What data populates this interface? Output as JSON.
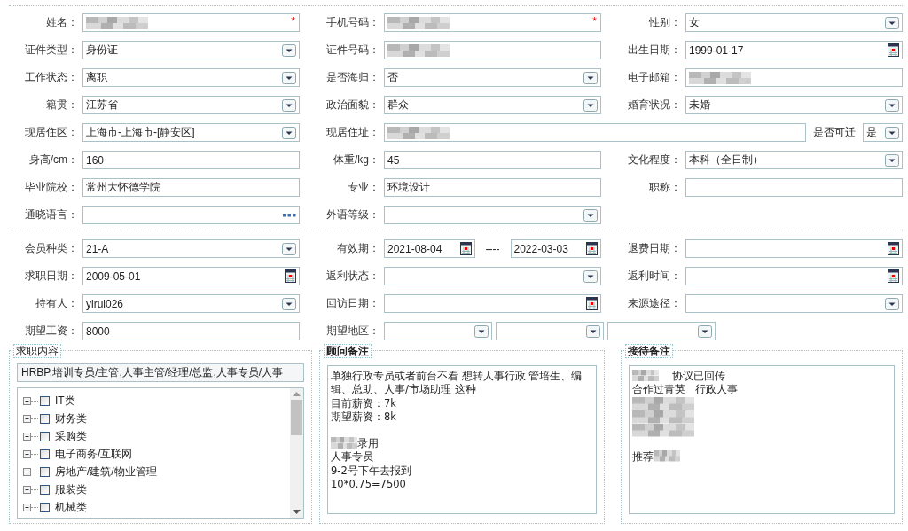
{
  "basic_rows": [
    [
      {
        "label": "姓名：",
        "controls": [
          {
            "kind": "text",
            "redacted": true,
            "required_mark": "*"
          }
        ]
      },
      {
        "label": "手机号码：",
        "controls": [
          {
            "kind": "text",
            "redacted": true,
            "required_mark": "*"
          }
        ]
      },
      {
        "label": "性别：",
        "controls": [
          {
            "kind": "select",
            "value": "女"
          }
        ]
      }
    ],
    [
      {
        "label": "证件类型：",
        "controls": [
          {
            "kind": "select",
            "value": "身份证"
          }
        ]
      },
      {
        "label": "证件号码：",
        "controls": [
          {
            "kind": "text",
            "redacted": true
          }
        ]
      },
      {
        "label": "出生日期：",
        "controls": [
          {
            "kind": "date",
            "value": "1999-01-17"
          }
        ]
      }
    ],
    [
      {
        "label": "工作状态：",
        "controls": [
          {
            "kind": "select",
            "value": "离职"
          }
        ]
      },
      {
        "label": "是否海归：",
        "controls": [
          {
            "kind": "select",
            "value": "否"
          }
        ]
      },
      {
        "label": "电子邮箱：",
        "controls": [
          {
            "kind": "text",
            "redacted": true
          }
        ]
      }
    ],
    [
      {
        "label": "籍贯：",
        "controls": [
          {
            "kind": "select",
            "value": "江苏省"
          }
        ]
      },
      {
        "label": "政治面貌：",
        "controls": [
          {
            "kind": "select",
            "value": "群众"
          }
        ]
      },
      {
        "label": "婚育状况：",
        "controls": [
          {
            "kind": "select",
            "value": "未婚"
          }
        ]
      }
    ],
    [
      {
        "label": "现居住区：",
        "controls": [
          {
            "kind": "select",
            "value": "上海市-上海市-[静安区]"
          }
        ]
      },
      {
        "label": "现居住址：",
        "controls": [
          {
            "kind": "text",
            "redacted": true
          },
          {
            "kind": "caption",
            "text": "是否可迁"
          },
          {
            "kind": "mini-select",
            "value": "是"
          }
        ]
      }
    ],
    [
      {
        "label": "身高/cm：",
        "controls": [
          {
            "kind": "text",
            "value": "160"
          }
        ]
      },
      {
        "label": "体重/kg：",
        "controls": [
          {
            "kind": "text",
            "value": "45"
          }
        ]
      },
      {
        "label": "文化程度：",
        "controls": [
          {
            "kind": "select",
            "value": "本科（全日制）"
          }
        ]
      }
    ],
    [
      {
        "label": "毕业院校：",
        "controls": [
          {
            "kind": "text",
            "value": "常州大怀德学院"
          }
        ]
      },
      {
        "label": "专业：",
        "controls": [
          {
            "kind": "text",
            "value": "环境设计"
          }
        ]
      },
      {
        "label": "职称：",
        "controls": [
          {
            "kind": "text"
          }
        ]
      }
    ],
    [
      {
        "label": "通晓语言：",
        "controls": [
          {
            "kind": "picker"
          }
        ]
      },
      {
        "label": "外语等级：",
        "controls": [
          {
            "kind": "select"
          }
        ]
      }
    ]
  ],
  "member_rows": [
    [
      {
        "label": "会员种类：",
        "controls": [
          {
            "kind": "select",
            "value": "21-A"
          }
        ]
      },
      {
        "label": "有效期：",
        "controls": [
          {
            "kind": "date",
            "value": "2021-08-04"
          },
          {
            "kind": "separator",
            "text": "----"
          },
          {
            "kind": "date",
            "value": "2022-03-03"
          }
        ]
      },
      {
        "label": "退费日期：",
        "controls": [
          {
            "kind": "date"
          }
        ]
      }
    ],
    [
      {
        "label": "求职日期：",
        "controls": [
          {
            "kind": "date",
            "value": "2009-05-01"
          }
        ]
      },
      {
        "label": "返利状态：",
        "controls": [
          {
            "kind": "select"
          }
        ]
      },
      {
        "label": "返利时间：",
        "controls": [
          {
            "kind": "date"
          }
        ]
      }
    ],
    [
      {
        "label": "持有人：",
        "controls": [
          {
            "kind": "select",
            "value": "yirui026"
          }
        ]
      },
      {
        "label": "回访日期：",
        "controls": [
          {
            "kind": "date"
          }
        ]
      },
      {
        "label": "来源途径：",
        "controls": [
          {
            "kind": "select"
          }
        ]
      }
    ],
    [
      {
        "label": "期望工资：",
        "controls": [
          {
            "kind": "text",
            "value": "8000"
          }
        ]
      },
      {
        "label": "期望地区：",
        "controls": [
          {
            "kind": "region-select"
          },
          {
            "kind": "region-select"
          },
          {
            "kind": "region-select"
          }
        ]
      }
    ]
  ],
  "job_panel": {
    "legend": "求职内容",
    "bold": false,
    "summary": "HRBP,培训专员/主管,人事主管/经理/总监,人事专员/人事",
    "tree": [
      {
        "label": "IT类",
        "checked": false,
        "expanded": false
      },
      {
        "label": "财务类",
        "checked": false,
        "expanded": false
      },
      {
        "label": "采购类",
        "checked": false,
        "expanded": false
      },
      {
        "label": "电子商务/互联网",
        "checked": false,
        "expanded": false
      },
      {
        "label": "房地产/建筑/物业管理",
        "checked": false,
        "expanded": false
      },
      {
        "label": "服装类",
        "checked": false,
        "expanded": false
      },
      {
        "label": "机械类",
        "checked": false,
        "expanded": false
      }
    ]
  },
  "advisor_panel": {
    "legend": "顾问备注",
    "bold": true,
    "lines": [
      {
        "kind": "text",
        "text": "单独行政专员或者前台不看 想转人事行政 管培生、编辑、总助、人事/市场助理 这种"
      },
      {
        "kind": "text",
        "text": "目前薪资：7k"
      },
      {
        "kind": "text",
        "text": "期望薪资：8k"
      },
      {
        "kind": "blank"
      },
      {
        "kind": "blur-before",
        "text": "录用"
      },
      {
        "kind": "text",
        "text": "人事专员"
      },
      {
        "kind": "text",
        "text": "9-2号下午去报到"
      },
      {
        "kind": "text",
        "text": "10*0.75=7500"
      }
    ]
  },
  "reception_panel": {
    "legend": "接待备注",
    "bold": true,
    "lines": [
      {
        "kind": "blur-before",
        "text": "    协议已回传"
      },
      {
        "kind": "text",
        "text": "合作过青英   行政人事"
      },
      {
        "kind": "blurred"
      },
      {
        "kind": "blurred"
      },
      {
        "kind": "blurred"
      },
      {
        "kind": "blank"
      },
      {
        "kind": "blur-after",
        "text": "推荐"
      }
    ]
  }
}
